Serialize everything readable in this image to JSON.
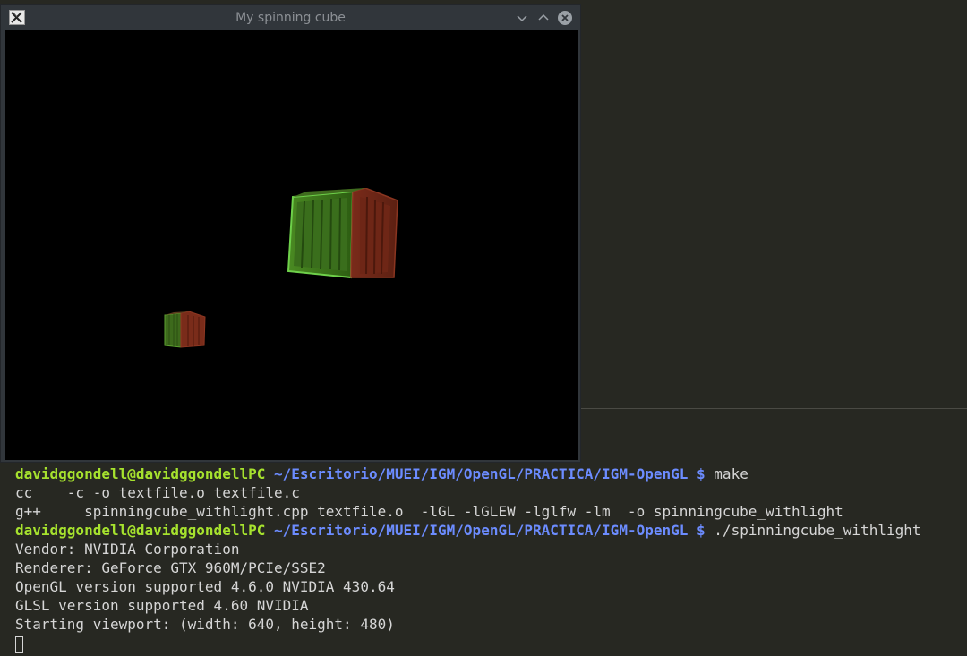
{
  "window": {
    "title": "My spinning cube",
    "icon": "x11-app-icon",
    "buttons": [
      "minimize",
      "maximize",
      "close"
    ]
  },
  "terminal": {
    "lines": [
      {
        "user": "davidggondell@davidggondellPC",
        "path": "~/Escritorio/MUEI/IGM/OpenGL/PRACTICA/IGM-OpenGL",
        "symbol": "$",
        "command": "make"
      },
      {
        "text": "cc    -c -o textfile.o textfile.c"
      },
      {
        "text": "g++     spinningcube_withlight.cpp textfile.o  -lGL -lGLEW -lglfw -lm  -o spinningcube_withlight"
      },
      {
        "user": "davidggondell@davidggondellPC",
        "path": "~/Escritorio/MUEI/IGM/OpenGL/PRACTICA/IGM-OpenGL",
        "symbol": "$",
        "command": "./spinningcube_withlight"
      },
      {
        "text": "Vendor: NVIDIA Corporation"
      },
      {
        "text": "Renderer: GeForce GTX 960M/PCIe/SSE2"
      },
      {
        "text": "OpenGL version supported 4.6.0 NVIDIA 430.64"
      },
      {
        "text": "GLSL version supported 4.60 NVIDIA"
      },
      {
        "text": "Starting viewport: (width: 640, height: 480)"
      }
    ]
  },
  "colors": {
    "terminal_bg": "#272822",
    "user_green": "#a6e22e",
    "path_blue": "#6c8cff",
    "text": "#d6d6d6"
  }
}
